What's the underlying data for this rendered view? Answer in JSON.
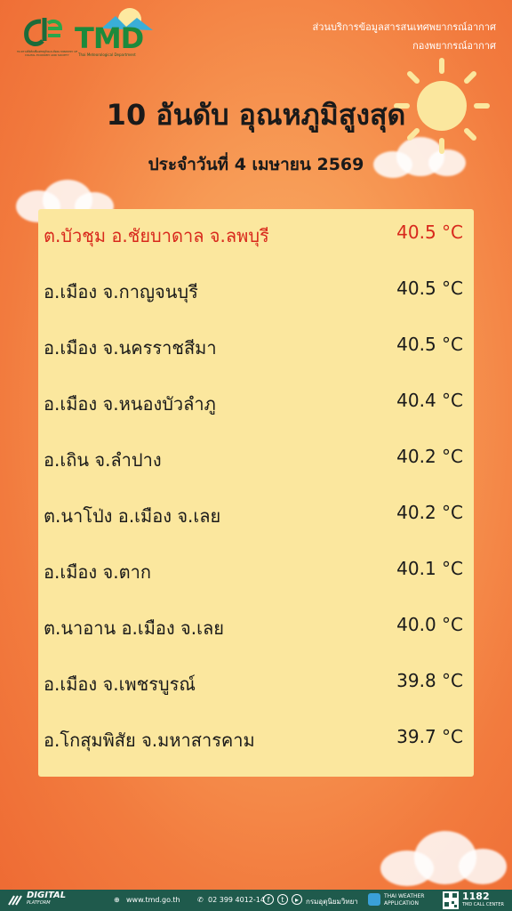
{
  "header": {
    "agency_line1": "ส่วนบริการข้อมูลสารสนเทศพยากรณ์อากาศ",
    "agency_line2": "กองพยากรณ์อากาศ",
    "logo_left_caption": "กระทรวงดิจิทัลเพื่อเศรษฐกิจและสังคม MINISTRY OF DIGITAL ECONOMY AND SOCIETY",
    "logo_tmd_text": "TMD",
    "logo_tmd_sub": "Thai Meteorological Department"
  },
  "title": "10 อันดับ อุณหภูมิสูงสุด",
  "subtitle": "ประจำวันที่ 4 เมษายน 2569",
  "rows": [
    {
      "place": "ต.บัวชุม อ.ชัยบาดาล จ.ลพบุรี",
      "temp": "40.5 °C"
    },
    {
      "place": "อ.เมือง จ.กาญจนบุรี",
      "temp": "40.5 °C"
    },
    {
      "place": "อ.เมือง จ.นครราชสีมา",
      "temp": "40.5 °C"
    },
    {
      "place": "อ.เมือง จ.หนองบัวลำภู",
      "temp": "40.4 °C"
    },
    {
      "place": "อ.เถิน จ.ลำปาง",
      "temp": "40.2 °C"
    },
    {
      "place": "ต.นาโป่ง อ.เมือง จ.เลย",
      "temp": "40.2 °C"
    },
    {
      "place": "อ.เมือง จ.ตาก",
      "temp": "40.1 °C"
    },
    {
      "place": "ต.นาอาน อ.เมือง จ.เลย",
      "temp": "40.0 °C"
    },
    {
      "place": "อ.เมือง จ.เพชรบูรณ์",
      "temp": "39.8 °C"
    },
    {
      "place": "อ.โกสุมพิสัย จ.มหาสารคาม",
      "temp": "39.7 °C"
    }
  ],
  "footer": {
    "platform": "DIGITAL",
    "platform_sub": "PLATFORM",
    "website": "www.tmd.go.th",
    "phone": "02 399 4012-14",
    "agency": "กรมอุตุนิยมวิทยา",
    "app": "THAI WEATHER APPLICATION",
    "hotline": "1182",
    "hotline_sub": "TMD CALL CENTER"
  },
  "colors": {
    "highlight": "#d8281c",
    "panel": "#fbe79e",
    "footer": "#1f5a4c"
  }
}
